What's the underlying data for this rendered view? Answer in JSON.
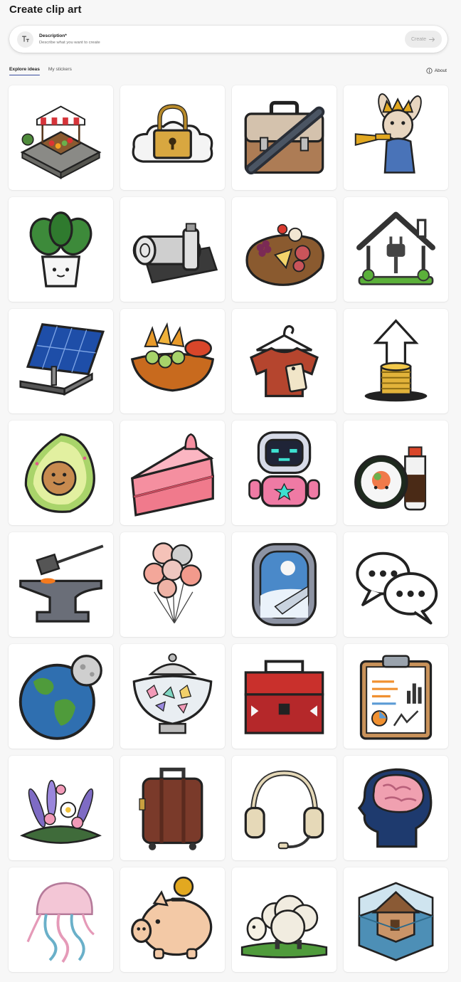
{
  "page": {
    "title": "Create clip art"
  },
  "description": {
    "label": "Description*",
    "placeholder": "Describe what you want to create",
    "icon": "text-format-icon"
  },
  "create_button": {
    "label": "Create",
    "icon": "arrow-right-icon"
  },
  "tabs": [
    {
      "label": "Explore ideas",
      "active": true
    },
    {
      "label": "My stickers",
      "active": false
    }
  ],
  "about": {
    "label": "About",
    "icon": "info-icon"
  },
  "colors": {
    "accent": "#3b4ea0",
    "background": "#f7f7f7",
    "card": "#ffffff"
  },
  "gallery": [
    {
      "icon": "market-stall-icon"
    },
    {
      "icon": "padlock-cloud-icon"
    },
    {
      "icon": "briefcase-icon"
    },
    {
      "icon": "rabbit-king-trumpet-icon"
    },
    {
      "icon": "potted-plant-icon"
    },
    {
      "icon": "yoga-mat-bottle-icon"
    },
    {
      "icon": "charcuterie-board-icon"
    },
    {
      "icon": "house-plug-icon"
    },
    {
      "icon": "solar-panel-icon"
    },
    {
      "icon": "snack-bowl-icon"
    },
    {
      "icon": "shirt-hanger-tag-icon"
    },
    {
      "icon": "coins-arrow-up-icon"
    },
    {
      "icon": "avocado-face-icon"
    },
    {
      "icon": "cake-slice-icon"
    },
    {
      "icon": "robot-icon"
    },
    {
      "icon": "sushi-soy-sauce-icon"
    },
    {
      "icon": "anvil-hammer-icon"
    },
    {
      "icon": "balloons-icon"
    },
    {
      "icon": "airplane-window-icon"
    },
    {
      "icon": "speech-bubbles-icon"
    },
    {
      "icon": "earth-moon-icon"
    },
    {
      "icon": "candy-jar-icon"
    },
    {
      "icon": "toolbox-icon"
    },
    {
      "icon": "clipboard-report-icon"
    },
    {
      "icon": "flower-bouquet-icon"
    },
    {
      "icon": "suitcase-icon"
    },
    {
      "icon": "headset-icon"
    },
    {
      "icon": "brain-head-icon"
    },
    {
      "icon": "jellyfish-icon"
    },
    {
      "icon": "piggy-bank-icon"
    },
    {
      "icon": "sheep-icon"
    },
    {
      "icon": "flooded-house-cube-icon"
    }
  ]
}
